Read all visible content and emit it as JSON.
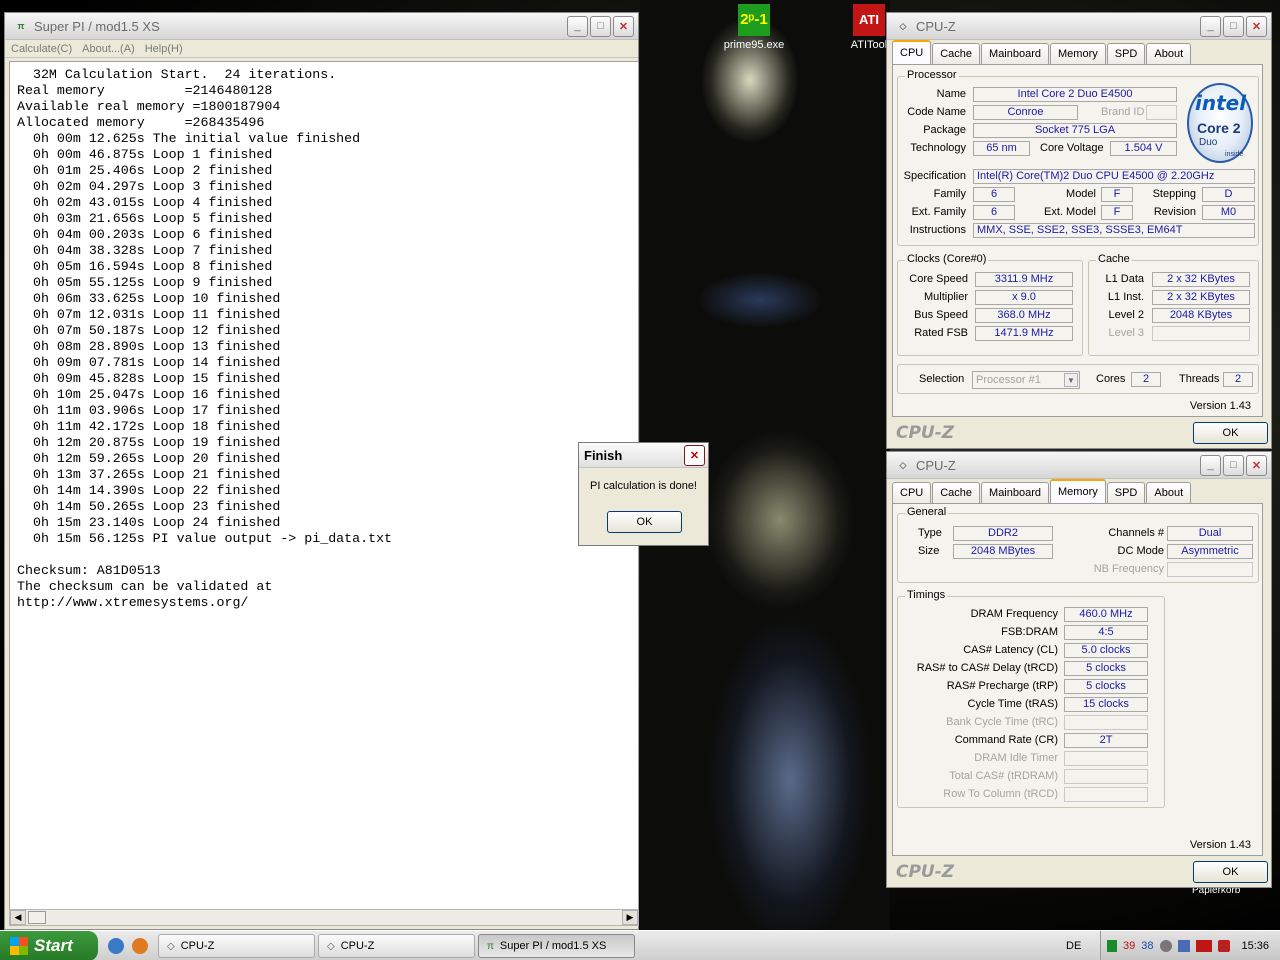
{
  "desktop": {
    "icons": [
      {
        "label": "prime95.exe",
        "glyph": "2ᵖ-1"
      },
      {
        "label": "ATITool",
        "glyph": "ATI"
      }
    ],
    "recycle_label": "Papierkorb"
  },
  "superpi": {
    "title": "Super PI / mod1.5 XS",
    "menu": [
      "Calculate(C)",
      "About...(A)",
      "Help(H)"
    ],
    "lines": [
      "  32M Calculation Start.  24 iterations.",
      "Real memory          =2146480128",
      "Available real memory =1800187904",
      "Allocated memory     =268435496",
      "  0h 00m 12.625s The initial value finished",
      "  0h 00m 46.875s Loop 1 finished",
      "  0h 01m 25.406s Loop 2 finished",
      "  0h 02m 04.297s Loop 3 finished",
      "  0h 02m 43.015s Loop 4 finished",
      "  0h 03m 21.656s Loop 5 finished",
      "  0h 04m 00.203s Loop 6 finished",
      "  0h 04m 38.328s Loop 7 finished",
      "  0h 05m 16.594s Loop 8 finished",
      "  0h 05m 55.125s Loop 9 finished",
      "  0h 06m 33.625s Loop 10 finished",
      "  0h 07m 12.031s Loop 11 finished",
      "  0h 07m 50.187s Loop 12 finished",
      "  0h 08m 28.890s Loop 13 finished",
      "  0h 09m 07.781s Loop 14 finished",
      "  0h 09m 45.828s Loop 15 finished",
      "  0h 10m 25.047s Loop 16 finished",
      "  0h 11m 03.906s Loop 17 finished",
      "  0h 11m 42.172s Loop 18 finished",
      "  0h 12m 20.875s Loop 19 finished",
      "  0h 12m 59.265s Loop 20 finished",
      "  0h 13m 37.265s Loop 21 finished",
      "  0h 14m 14.390s Loop 22 finished",
      "  0h 14m 50.265s Loop 23 finished",
      "  0h 15m 23.140s Loop 24 finished",
      "  0h 15m 56.125s PI value output -> pi_data.txt",
      "",
      "Checksum: A81D0513",
      "The checksum can be validated at",
      "http://www.xtremesystems.org/"
    ]
  },
  "finish_dialog": {
    "title": "Finish",
    "message": "PI calculation is done!",
    "ok": "OK"
  },
  "cpuz_cpu": {
    "title": "CPU-Z",
    "tabs": [
      "CPU",
      "Cache",
      "Mainboard",
      "Memory",
      "SPD",
      "About"
    ],
    "processor_group": "Processor",
    "labels": {
      "name": "Name",
      "code_name": "Code Name",
      "brand_id": "Brand ID",
      "package": "Package",
      "technology": "Technology",
      "core_voltage": "Core Voltage",
      "specification": "Specification",
      "family": "Family",
      "model": "Model",
      "stepping": "Stepping",
      "ext_family": "Ext. Family",
      "ext_model": "Ext. Model",
      "revision": "Revision",
      "instructions": "Instructions"
    },
    "values": {
      "name": "Intel Core 2 Duo E4500",
      "code_name": "Conroe",
      "brand_id": "",
      "package": "Socket 775 LGA",
      "technology": "65 nm",
      "core_voltage": "1.504 V",
      "specification": "Intel(R) Core(TM)2 Duo CPU     E4500  @ 2.20GHz",
      "family": "6",
      "model": "F",
      "stepping": "D",
      "ext_family": "6",
      "ext_model": "F",
      "revision": "M0",
      "instructions": "MMX, SSE, SSE2, SSE3, SSSE3, EM64T"
    },
    "logo": {
      "brand": "intel",
      "line1": "Core 2",
      "line2": "Duo",
      "line3": "inside"
    },
    "clocks_group": "Clocks (Core#0)",
    "clocks": [
      {
        "label": "Core Speed",
        "value": "3311.9 MHz"
      },
      {
        "label": "Multiplier",
        "value": "x 9.0"
      },
      {
        "label": "Bus Speed",
        "value": "368.0 MHz"
      },
      {
        "label": "Rated FSB",
        "value": "1471.9 MHz"
      }
    ],
    "cache_group": "Cache",
    "cache": [
      {
        "label": "L1 Data",
        "value": "2 x 32 KBytes"
      },
      {
        "label": "L1 Inst.",
        "value": "2 x 32 KBytes"
      },
      {
        "label": "Level 2",
        "value": "2048 KBytes"
      },
      {
        "label": "Level 3",
        "value": ""
      }
    ],
    "selection_label": "Selection",
    "selection_value": "Processor #1",
    "cores_label": "Cores",
    "cores_value": "2",
    "threads_label": "Threads",
    "threads_value": "2",
    "version": "Version 1.43",
    "logo_text": "CPU-Z",
    "ok": "OK"
  },
  "cpuz_mem": {
    "title": "CPU-Z",
    "tabs": [
      "CPU",
      "Cache",
      "Mainboard",
      "Memory",
      "SPD",
      "About"
    ],
    "general_group": "General",
    "type_label": "Type",
    "type_value": "DDR2",
    "size_label": "Size",
    "size_value": "2048 MBytes",
    "channels_label": "Channels #",
    "channels_value": "Dual",
    "dcmode_label": "DC Mode",
    "dcmode_value": "Asymmetric",
    "nbfreq_label": "NB Frequency",
    "nbfreq_value": "",
    "timings_group": "Timings",
    "timings": [
      {
        "label": "DRAM Frequency",
        "value": "460.0 MHz"
      },
      {
        "label": "FSB:DRAM",
        "value": "4:5"
      },
      {
        "label": "CAS# Latency (CL)",
        "value": "5.0 clocks"
      },
      {
        "label": "RAS# to CAS# Delay (tRCD)",
        "value": "5 clocks"
      },
      {
        "label": "RAS# Precharge (tRP)",
        "value": "5 clocks"
      },
      {
        "label": "Cycle Time (tRAS)",
        "value": "15 clocks"
      },
      {
        "label": "Bank Cycle Time (tRC)",
        "value": ""
      },
      {
        "label": "Command Rate (CR)",
        "value": "2T"
      },
      {
        "label": "DRAM Idle Timer",
        "value": ""
      },
      {
        "label": "Total CAS# (tRDRAM)",
        "value": ""
      },
      {
        "label": "Row To Column (tRCD)",
        "value": ""
      }
    ],
    "version": "Version 1.43",
    "logo_text": "CPU-Z",
    "ok": "OK"
  },
  "taskbar": {
    "start": "Start",
    "tasks": [
      "CPU-Z",
      "CPU-Z",
      "Super PI / mod1.5 XS"
    ],
    "lang": "DE",
    "tray_numbers": [
      "39",
      "38"
    ],
    "clock": "15:36"
  }
}
